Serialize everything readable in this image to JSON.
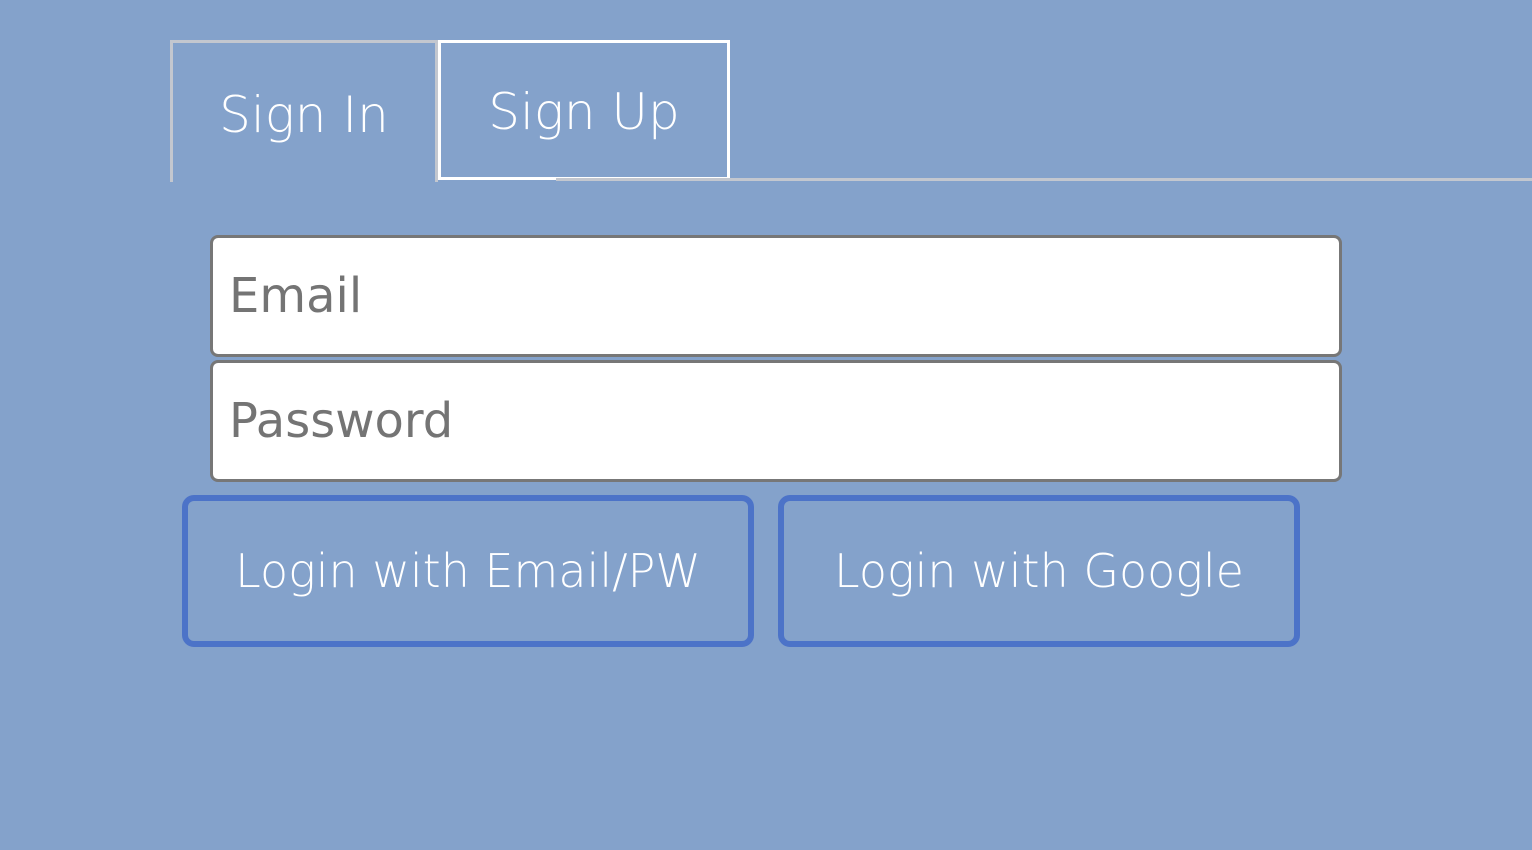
{
  "tabs": [
    {
      "label": "Sign In",
      "active": false
    },
    {
      "label": "Sign Up",
      "active": true
    }
  ],
  "form": {
    "email": {
      "value": "",
      "placeholder": "Email"
    },
    "password": {
      "value": "",
      "placeholder": "Password"
    }
  },
  "buttons": {
    "email_login": "Login with Email/PW",
    "google_login": "Login with Google"
  },
  "colors": {
    "background": "#84a2cb",
    "tab_border": "#c3c7cf",
    "active_tab_border": "#ffffff",
    "button_border": "#4c73c8",
    "input_border": "#777777"
  }
}
